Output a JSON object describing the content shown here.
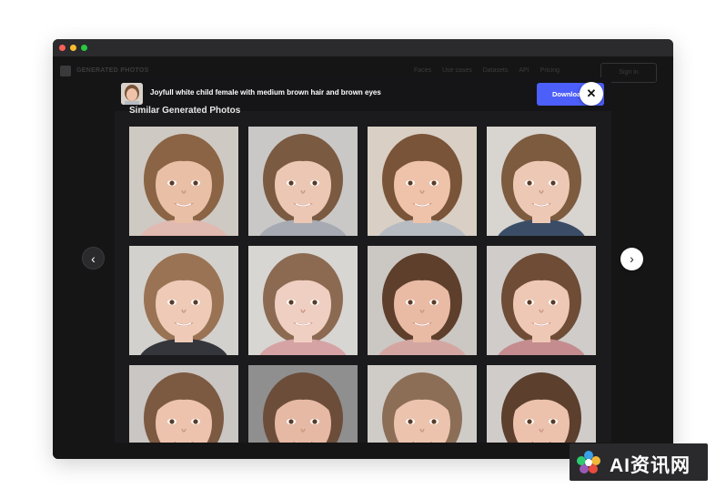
{
  "background_app": {
    "brand": "GENERATED PHOTOS",
    "nav_links": [
      "Faces",
      "Use cases",
      "Datasets",
      "API",
      "Pricing"
    ],
    "sign_in": "Sign in"
  },
  "modal": {
    "title": "Joyfull white child female with medium brown hair and brown eyes",
    "download_label": "Download",
    "close_icon": "close-icon",
    "section_title": "Similar Generated Photos"
  },
  "photos": [
    {
      "skin": "#e9bfa6",
      "hair": "#8a6444",
      "bg": "#cfc9c3",
      "shirt": "#e0b9b0"
    },
    {
      "skin": "#ecc8b4",
      "hair": "#7b5a42",
      "bg": "#c9c8c6",
      "shirt": "#a7aab2"
    },
    {
      "skin": "#eec3a9",
      "hair": "#7a5438",
      "bg": "#d9cfc4",
      "shirt": "#b7bcc3"
    },
    {
      "skin": "#edc9b5",
      "hair": "#7d5b3f",
      "bg": "#d8d4d0",
      "shirt": "#3b4d66"
    },
    {
      "skin": "#eecab7",
      "hair": "#9a7354",
      "bg": "#d3d1cd",
      "shirt": "#34363c"
    },
    {
      "skin": "#efcfc1",
      "hair": "#8c6a52",
      "bg": "#d8d6d3",
      "shirt": "#d6a3a4"
    },
    {
      "skin": "#e9bba4",
      "hair": "#5e3f2c",
      "bg": "#cbc7c3",
      "shirt": "#d4a6a2"
    },
    {
      "skin": "#efc8b5",
      "hair": "#6e4c35",
      "bg": "#cfccca",
      "shirt": "#c48c8e"
    },
    {
      "skin": "#edc3ad",
      "hair": "#7c5941",
      "bg": "#c9c6c3",
      "shirt": "#9b8c84"
    },
    {
      "skin": "#e6b9a4",
      "hair": "#6b4d3a",
      "bg": "#8f8f8f",
      "shirt": "#7b7b7b"
    },
    {
      "skin": "#ecc4ae",
      "hair": "#8c6e57",
      "bg": "#cfccc8",
      "shirt": "#c2b1a5"
    },
    {
      "skin": "#ecc2ad",
      "hair": "#5c3f2d",
      "bg": "#d0ccca",
      "shirt": "#b99b93"
    }
  ],
  "nav_arrows": {
    "prev_icon": "chevron-left-icon",
    "next_icon": "chevron-right-icon"
  },
  "watermark": {
    "text": "AI资讯网",
    "logo_icon": "flower-logo-icon"
  },
  "colors": {
    "accent": "#4c5ffa",
    "modal_bg": "#1b1b1d"
  }
}
